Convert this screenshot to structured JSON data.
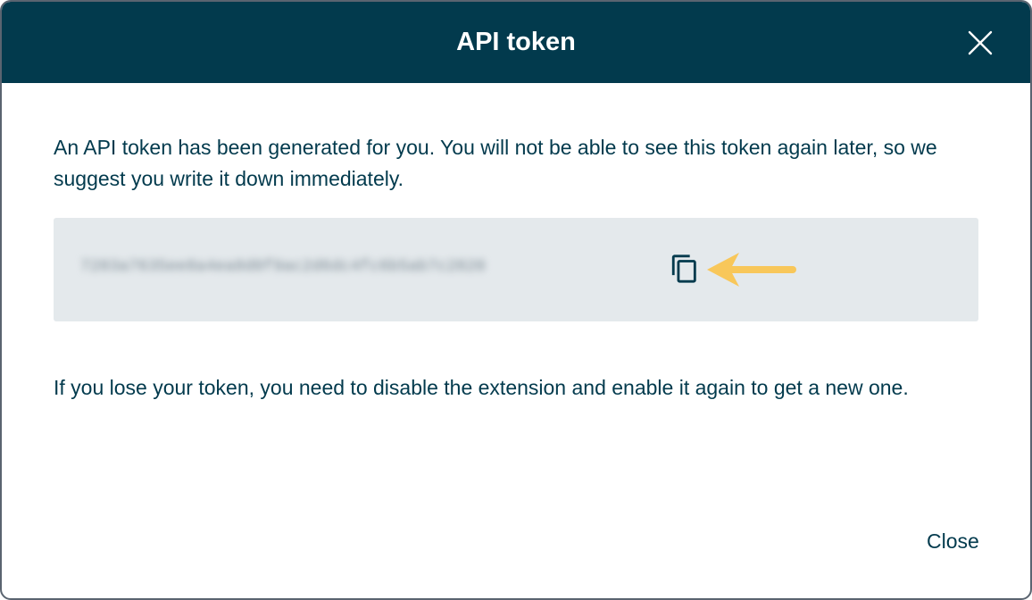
{
  "dialog": {
    "title": "API token",
    "close_icon": "close-icon",
    "intro_text": "An API token has been generated for you. You will not be able to see this token again later, so we suggest you write it down immediately.",
    "token": {
      "value": "7283a7635ee8a4ea8d0f9ac2d6dc4fc6b5ab7c2820",
      "copy_icon": "copy-icon",
      "arrow_icon": "arrow-left-icon",
      "arrow_color": "#f8c75a"
    },
    "warning_text": "If you lose your token, you need to disable the extension and enable it again to get a new one.",
    "close_label": "Close"
  },
  "colors": {
    "header_bg": "#023a4d",
    "text": "#023a4d",
    "token_bg": "#e4e9ec"
  }
}
